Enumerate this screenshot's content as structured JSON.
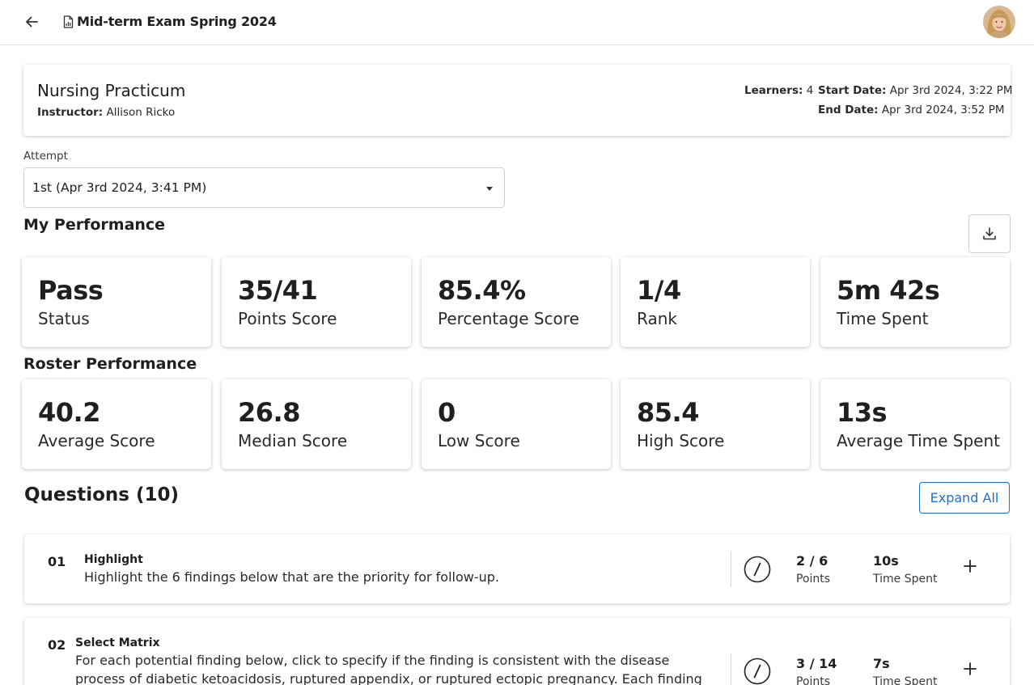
{
  "header": {
    "back_icon": "arrow-left-icon",
    "doc_icon": "document-icon",
    "title": "Mid-term Exam Spring 2024"
  },
  "course": {
    "name": "Nursing Practicum",
    "instructor_label": "Instructor:",
    "instructor": "Allison Ricko",
    "learners_label": "Learners:",
    "learners": "4",
    "start_label": "Start Date:",
    "start": "Apr 3rd 2024, 3:22 PM",
    "end_label": "End Date:",
    "end": "Apr 3rd 2024, 3:52 PM"
  },
  "attempt": {
    "label": "Attempt",
    "value": "1st (Apr 3rd 2024, 3:41 PM)"
  },
  "my_performance": {
    "title": "My Performance",
    "download_icon": "download-icon",
    "stats": [
      {
        "value": "Pass",
        "label": "Status"
      },
      {
        "value": "35/41",
        "label": "Points Score"
      },
      {
        "value": "85.4%",
        "label": "Percentage Score"
      },
      {
        "value": "1/4",
        "label": "Rank"
      },
      {
        "value": "5m 42s",
        "label": "Time Spent"
      }
    ]
  },
  "roster_performance": {
    "title": "Roster Performance",
    "stats": [
      {
        "value": "40.2",
        "label": "Average Score"
      },
      {
        "value": "26.8",
        "label": "Median Score"
      },
      {
        "value": "0",
        "label": "Low Score"
      },
      {
        "value": "85.4",
        "label": "High Score"
      },
      {
        "value": "13s",
        "label": "Average Time Spent"
      }
    ]
  },
  "questions": {
    "title": "Questions (10)",
    "expand_all_label": "Expand All",
    "items": [
      {
        "number": "01",
        "type": "Highlight",
        "text": "Highlight the 6 findings below that are the priority for follow-up.",
        "status_icon": "slash-circle-icon",
        "points": "2 / 6",
        "points_label": "Points",
        "time": "10s",
        "time_label": "Time Spent",
        "expand_icon": "plus-icon"
      },
      {
        "number": "02",
        "type": "Select Matrix",
        "text": "For each potential finding below, click to specify if the finding is consistent with the disease process of diabetic ketoacidosis, ruptured appendix, or ruptured ectopic pregnancy. Each finding may support more",
        "status_icon": "slash-circle-icon",
        "points": "3 / 14",
        "points_label": "Points",
        "time": "7s",
        "time_label": "Time Spent",
        "expand_icon": "plus-icon"
      }
    ]
  }
}
